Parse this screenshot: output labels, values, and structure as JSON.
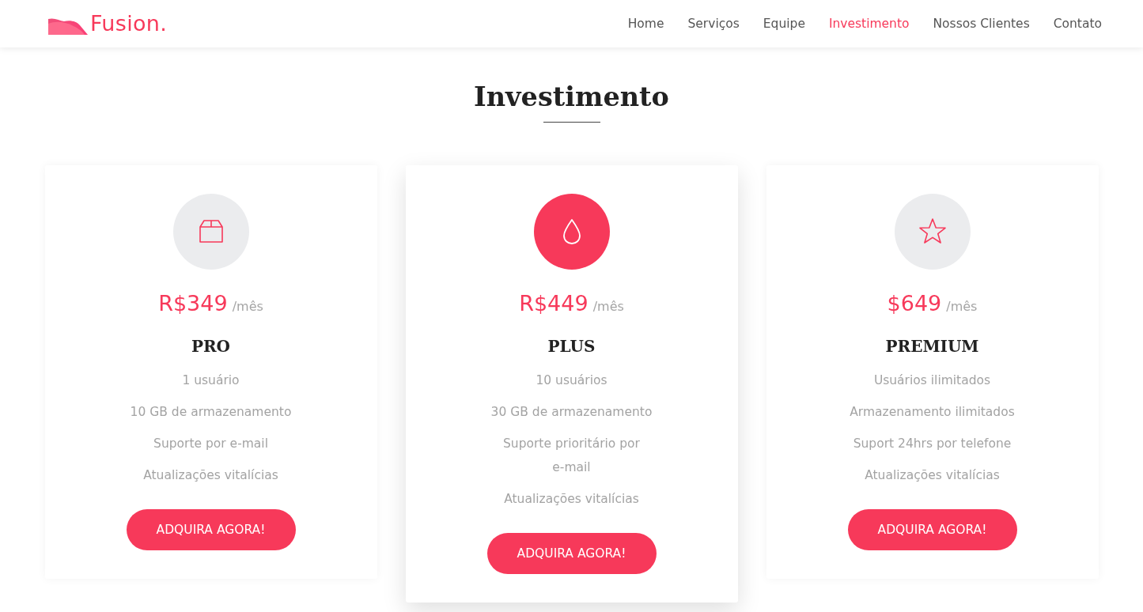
{
  "header": {
    "logo": {
      "text": "Fusion."
    },
    "nav": [
      {
        "label": "Home",
        "selected": false
      },
      {
        "label": "Serviços",
        "selected": false
      },
      {
        "label": "Equipe",
        "selected": false
      },
      {
        "label": "Investimento",
        "selected": true
      },
      {
        "label": "Nossos Clientes",
        "selected": false
      },
      {
        "label": "Contato",
        "selected": false
      }
    ]
  },
  "section": {
    "title": "Investimento"
  },
  "plans": [
    {
      "kind": "box",
      "featured": false,
      "price": "R$349",
      "period": "/mês",
      "name": "PRO",
      "features": [
        "1 usuário",
        "10 GB de armazenamento",
        "Suporte por e-mail",
        "Atualizações vitalícias"
      ],
      "button": "ADQUIRA AGORA!"
    },
    {
      "kind": "drop",
      "featured": true,
      "price": "R$449",
      "period": "/mês",
      "name": "PLUS",
      "features": [
        "10 usuários",
        "30 GB de armazenamento",
        "Suporte prioritário por e-mail",
        "Atualizações vitalícias"
      ],
      "button": "ADQUIRA AGORA!"
    },
    {
      "kind": "star",
      "featured": false,
      "price": "$649",
      "period": "/mês",
      "name": "PREMIUM",
      "features": [
        "Usuários ilimitados",
        "Armazenamento ilimitados",
        "Suport 24hrs por telefone",
        "Atualizações vitalícias"
      ],
      "button": "ADQUIRA AGORA!"
    }
  ]
}
